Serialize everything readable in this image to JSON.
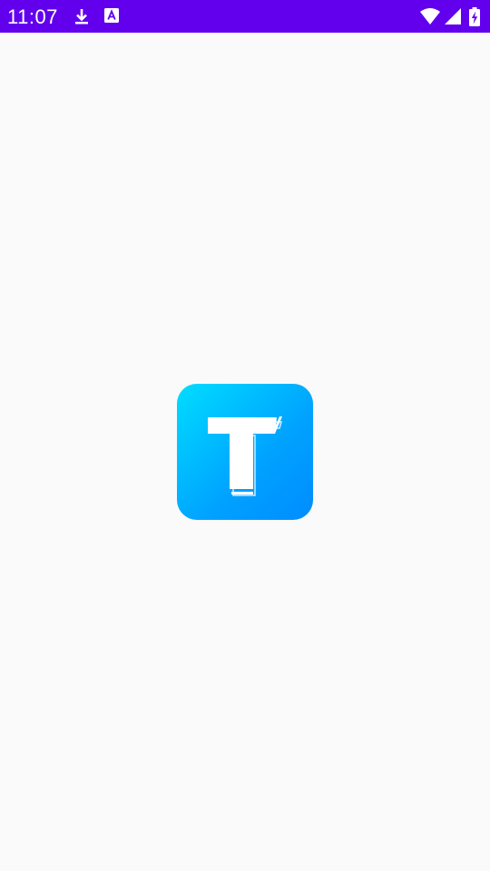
{
  "status_bar": {
    "time": "11:07",
    "background_color": "#6200ee",
    "icons": [
      "download-icon",
      "text-a-icon",
      "wifi-icon",
      "cell-signal-icon",
      "battery-charging-icon"
    ]
  },
  "splash": {
    "background_color": "#fafafa",
    "logo": {
      "glyph": "T",
      "gradient_start": "#00ddff",
      "gradient_end": "#008cff"
    }
  }
}
